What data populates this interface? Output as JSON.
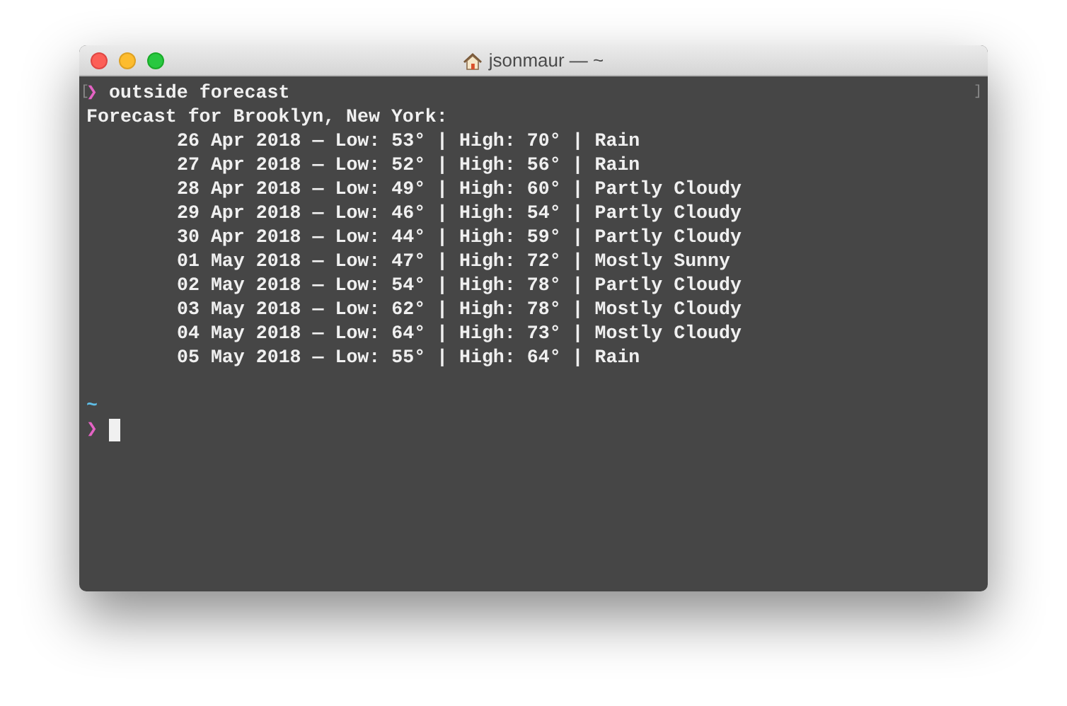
{
  "window": {
    "title": "jsonmaur — ~"
  },
  "terminal": {
    "mark_left": "[",
    "mark_right": "]",
    "prompt_symbol": "❯",
    "command": "outside forecast",
    "heading": "Forecast for Brooklyn, New York:",
    "forecast_lines": [
      "26 Apr 2018 — Low: 53° | High: 70° | Rain",
      "27 Apr 2018 — Low: 52° | High: 56° | Rain",
      "28 Apr 2018 — Low: 49° | High: 60° | Partly Cloudy",
      "29 Apr 2018 — Low: 46° | High: 54° | Partly Cloudy",
      "30 Apr 2018 — Low: 44° | High: 59° | Partly Cloudy",
      "01 May 2018 — Low: 47° | High: 72° | Mostly Sunny",
      "02 May 2018 — Low: 54° | High: 78° | Partly Cloudy",
      "03 May 2018 — Low: 62° | High: 78° | Mostly Cloudy",
      "04 May 2018 — Low: 64° | High: 73° | Mostly Cloudy",
      "05 May 2018 — Low: 55° | High: 64° | Rain"
    ],
    "cwd": "~",
    "prompt_symbol_2": "❯"
  }
}
